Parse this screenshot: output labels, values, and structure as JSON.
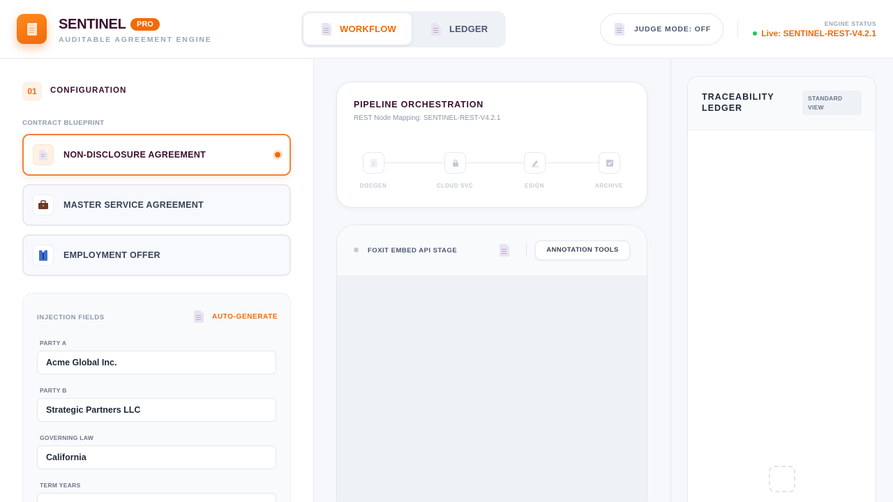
{
  "header": {
    "brand": "SENTINEL",
    "badge": "PRO",
    "subtitle": "AUDITABLE AGREEMENT ENGINE",
    "tabs": [
      {
        "label": "WORKFLOW",
        "active": true
      },
      {
        "label": "LEDGER",
        "active": false
      }
    ],
    "judge_mode": "JUDGE MODE: OFF",
    "engine_status_label": "ENGINE STATUS",
    "engine_status_value": "Live: SENTINEL-REST-V4.2.1"
  },
  "config": {
    "step": "01",
    "title": "CONFIGURATION",
    "blueprint_label": "CONTRACT BLUEPRINT",
    "blueprints": [
      {
        "label": "NON-DISCLOSURE AGREEMENT",
        "icon": "document-icon",
        "selected": true
      },
      {
        "label": "MASTER SERVICE AGREEMENT",
        "icon": "briefcase-icon",
        "selected": false
      },
      {
        "label": "EMPLOYMENT OFFER",
        "icon": "person-suit-icon",
        "selected": false
      }
    ],
    "injection_title": "INJECTION FIELDS",
    "autogen": "AUTO-GENERATE",
    "fields": [
      {
        "label": "PARTY A",
        "value": "Acme Global Inc."
      },
      {
        "label": "PARTY B",
        "value": "Strategic Partners LLC"
      },
      {
        "label": "GOVERNING LAW",
        "value": "California"
      },
      {
        "label": "TERM YEARS",
        "value": ""
      }
    ]
  },
  "pipeline": {
    "title": "PIPELINE ORCHESTRATION",
    "subtitle": "REST Node Mapping: SENTINEL-REST-V4.2.1",
    "nodes": [
      {
        "label": "DOCGEN",
        "icon": "document-icon"
      },
      {
        "label": "CLOUD SVC",
        "icon": "lock-icon"
      },
      {
        "label": "ESIGN",
        "icon": "signature-icon"
      },
      {
        "label": "ARCHIVE",
        "icon": "checkbox-icon"
      }
    ]
  },
  "stage": {
    "title": "FOXIT EMBED API STAGE",
    "annotation_button": "ANNOTATION TOOLS"
  },
  "ledger": {
    "title": "TRACEABILITY LEDGER",
    "view_button": "STANDARD VIEW"
  },
  "colors": {
    "accent": "#f26a0a",
    "brand_dark": "#3b0f2e",
    "live": "#22c55e"
  }
}
